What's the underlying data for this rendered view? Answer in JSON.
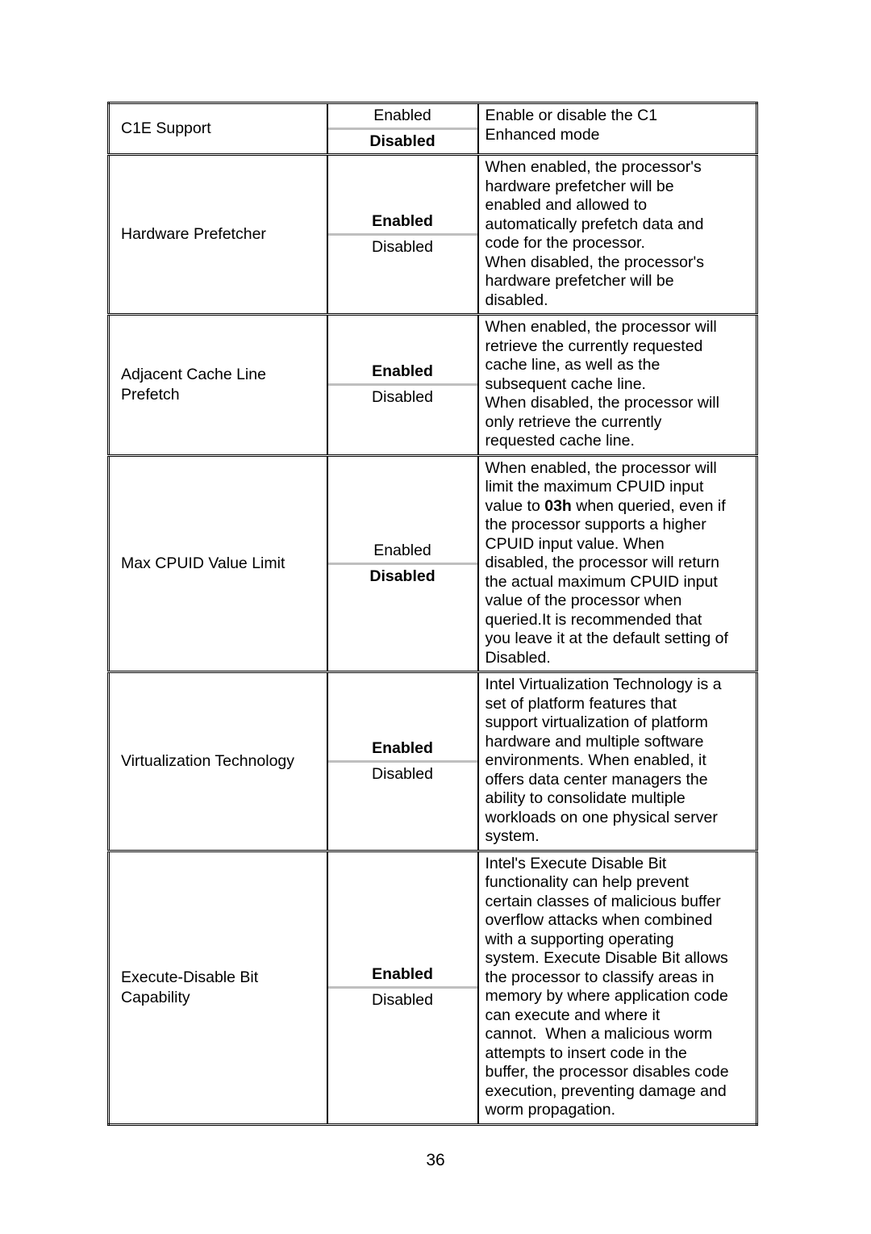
{
  "document": {
    "page_number": "36",
    "table": {
      "rows": [
        {
          "name": "C1E Support",
          "options": [
            {
              "label": "Enabled",
              "is_default": false
            },
            {
              "label": "Disabled",
              "is_default": true
            }
          ],
          "description_lines": [
            "Enable or disable the C1",
            "Enhanced mode"
          ]
        },
        {
          "name": "Hardware Prefetcher",
          "options": [
            {
              "label": "Enabled",
              "is_default": true
            },
            {
              "label": "Disabled",
              "is_default": false
            }
          ],
          "description_lines": [
            "When enabled, the processor's",
            "hardware prefetcher will be",
            "enabled and allowed to",
            "automatically prefetch data and",
            "code for the processor.",
            "When disabled, the processor's",
            "hardware prefetcher will be",
            "disabled."
          ]
        },
        {
          "name": "Adjacent Cache Line Prefetch",
          "options": [
            {
              "label": "Enabled",
              "is_default": true
            },
            {
              "label": "Disabled",
              "is_default": false
            }
          ],
          "description_lines": [
            "When enabled, the processor will",
            "retrieve the currently requested",
            "cache line, as well as the",
            "subsequent cache line.",
            "When disabled, the processor will",
            "only retrieve the currently",
            "requested cache line."
          ]
        },
        {
          "name": "Max CPUID Value Limit",
          "options": [
            {
              "label": "Enabled",
              "is_default": false
            },
            {
              "label": "Disabled",
              "is_default": true
            }
          ],
          "description_lines": [
            "When enabled, the processor will",
            "limit the maximum CPUID input",
            "value to <b>03h</b> when queried, even if",
            "the processor supports a higher",
            "CPUID input value. When",
            "disabled, the processor will return",
            "the actual maximum CPUID input",
            "value of the processor when",
            "queried.It is recommended that",
            "you leave it at the default setting of",
            "Disabled."
          ]
        },
        {
          "name": "Virtualization Technology",
          "options": [
            {
              "label": "Enabled",
              "is_default": true
            },
            {
              "label": "Disabled",
              "is_default": false
            }
          ],
          "description_lines": [
            "Intel Virtualization Technology is a",
            "set of platform features that",
            "support virtualization of platform",
            "hardware and multiple software",
            "environments. When enabled, it",
            "offers data center managers the",
            "ability to consolidate multiple",
            "workloads on one physical server",
            "system."
          ]
        },
        {
          "name": "Execute-Disable Bit Capability",
          "options": [
            {
              "label": "Enabled",
              "is_default": true
            },
            {
              "label": "Disabled",
              "is_default": false
            }
          ],
          "description_lines": [
            "Intel's Execute Disable Bit",
            "functionality can help prevent",
            "certain classes of malicious buffer",
            "overflow attacks when combined",
            "with a supporting operating",
            "system. Execute Disable Bit allows",
            "the processor to classify areas in",
            "memory by where application code",
            "can execute and where it",
            "cannot.  When a malicious worm",
            "attempts to insert code in the",
            "buffer, the processor disables code",
            "execution, preventing damage and",
            "worm propagation."
          ]
        }
      ]
    }
  }
}
